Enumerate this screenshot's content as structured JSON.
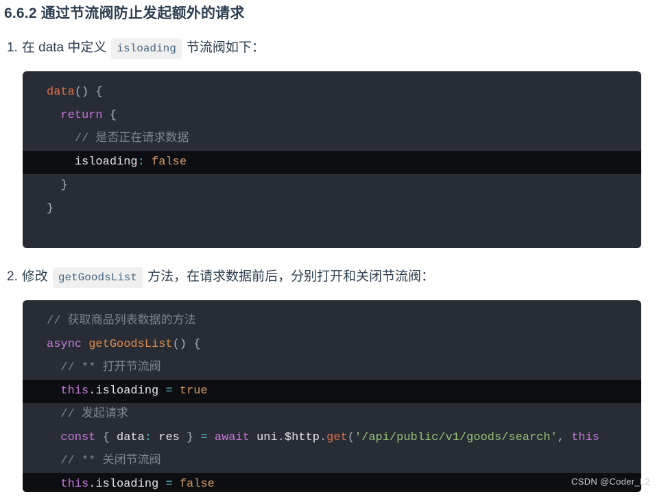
{
  "heading": {
    "number": "6.6.2",
    "text": "通过节流阀防止发起额外的请求"
  },
  "steps": [
    {
      "marker": "1.",
      "text_before": "在 data 中定义",
      "code_chip": "isloading",
      "text_after": "节流阀如下："
    },
    {
      "marker": "2.",
      "text_before": "修改",
      "code_chip": "getGoodsList",
      "text_after": "方法，在请求数据前后，分别打开和关闭节流阀："
    }
  ],
  "code_block_1": {
    "language": "javascript",
    "lines": [
      {
        "indent": 0,
        "highlighted": false,
        "tokens": [
          {
            "t": "data",
            "c": "t-fn"
          },
          {
            "t": "() {",
            "c": "t-punc"
          }
        ]
      },
      {
        "indent": 1,
        "highlighted": false,
        "tokens": [
          {
            "t": "return",
            "c": "t-kw"
          },
          {
            "t": " {",
            "c": "t-punc"
          }
        ]
      },
      {
        "indent": 2,
        "highlighted": false,
        "tokens": [
          {
            "t": "// 是否正在请求数据",
            "c": "t-cmt"
          }
        ]
      },
      {
        "indent": 2,
        "highlighted": true,
        "tokens": [
          {
            "t": "isloading",
            "c": "t-plain"
          },
          {
            "t": ":",
            "c": "t-op"
          },
          {
            "t": " ",
            "c": "t-punc"
          },
          {
            "t": "false",
            "c": "t-val"
          }
        ]
      },
      {
        "indent": 1,
        "highlighted": false,
        "tokens": [
          {
            "t": "}",
            "c": "t-punc"
          }
        ]
      },
      {
        "indent": 0,
        "highlighted": false,
        "tokens": [
          {
            "t": "}",
            "c": "t-punc"
          }
        ]
      }
    ]
  },
  "code_block_2": {
    "language": "javascript",
    "lines": [
      {
        "indent": 0,
        "highlighted": false,
        "tokens": [
          {
            "t": "// 获取商品列表数据的方法",
            "c": "t-cmt"
          }
        ]
      },
      {
        "indent": 0,
        "highlighted": false,
        "tokens": [
          {
            "t": "async",
            "c": "t-kw"
          },
          {
            "t": " ",
            "c": "t-punc"
          },
          {
            "t": "getGoodsList",
            "c": "t-fn2"
          },
          {
            "t": "() {",
            "c": "t-punc"
          }
        ]
      },
      {
        "indent": 1,
        "highlighted": false,
        "tokens": [
          {
            "t": "// ** 打开节流阀",
            "c": "t-cmt"
          }
        ]
      },
      {
        "indent": 1,
        "highlighted": true,
        "tokens": [
          {
            "t": "this",
            "c": "t-kw"
          },
          {
            "t": ".isloading",
            "c": "t-plain"
          },
          {
            "t": " ",
            "c": "t-punc"
          },
          {
            "t": "=",
            "c": "t-op"
          },
          {
            "t": " ",
            "c": "t-punc"
          },
          {
            "t": "true",
            "c": "t-val"
          }
        ]
      },
      {
        "indent": 1,
        "highlighted": false,
        "tokens": [
          {
            "t": "// 发起请求",
            "c": "t-cmt"
          }
        ]
      },
      {
        "indent": 1,
        "highlighted": false,
        "tokens": [
          {
            "t": "const",
            "c": "t-kw"
          },
          {
            "t": " { ",
            "c": "t-punc"
          },
          {
            "t": "data",
            "c": "t-plain"
          },
          {
            "t": ":",
            "c": "t-op"
          },
          {
            "t": " ",
            "c": "t-punc"
          },
          {
            "t": "res",
            "c": "t-plain"
          },
          {
            "t": " } ",
            "c": "t-punc"
          },
          {
            "t": "=",
            "c": "t-op"
          },
          {
            "t": " ",
            "c": "t-punc"
          },
          {
            "t": "await",
            "c": "t-kw"
          },
          {
            "t": " ",
            "c": "t-punc"
          },
          {
            "t": "uni",
            "c": "t-plain"
          },
          {
            "t": ".",
            "c": "t-punc"
          },
          {
            "t": "$http",
            "c": "t-plain"
          },
          {
            "t": ".",
            "c": "t-punc"
          },
          {
            "t": "get",
            "c": "t-prop"
          },
          {
            "t": "(",
            "c": "t-punc"
          },
          {
            "t": "'/api/public/v1/goods/search'",
            "c": "t-str"
          },
          {
            "t": ", ",
            "c": "t-punc"
          },
          {
            "t": "this",
            "c": "t-kw"
          }
        ]
      },
      {
        "indent": 1,
        "highlighted": false,
        "tokens": [
          {
            "t": "// ** 关闭节流阀",
            "c": "t-cmt"
          }
        ]
      },
      {
        "indent": 1,
        "highlighted": true,
        "tokens": [
          {
            "t": "this",
            "c": "t-kw"
          },
          {
            "t": ".isloading",
            "c": "t-plain"
          },
          {
            "t": " ",
            "c": "t-punc"
          },
          {
            "t": "=",
            "c": "t-op"
          },
          {
            "t": " ",
            "c": "t-punc"
          },
          {
            "t": "false",
            "c": "t-val"
          }
        ]
      }
    ]
  },
  "watermark": "CSDN @Coder_L2",
  "colors": {
    "page_background": "#ffffff",
    "heading_text": "#2c3e50",
    "body_text": "#2c3e50",
    "inline_code_background": "#f0f0f0",
    "inline_code_text": "#476582",
    "code_background": "#282c34",
    "code_highlight_background": "#0d0e11",
    "keyword": "#c678dd",
    "function": "#e06c4f",
    "string": "#98c379",
    "literal": "#d19a66",
    "operator": "#56b6c2",
    "comment": "#7f848e",
    "watermark_text": "#c9ccd1"
  }
}
